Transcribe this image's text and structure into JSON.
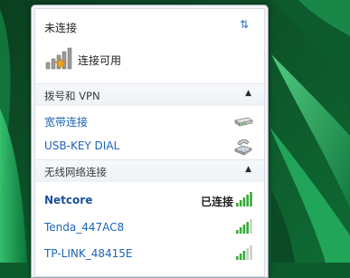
{
  "header": {
    "status_text": "未连接",
    "refresh_glyph": "⇅",
    "connection_label": "连接可用"
  },
  "sections": {
    "dialup": {
      "title": "拨号和 VPN",
      "items": [
        {
          "label": "宽带连接",
          "icon": "modem-icon"
        },
        {
          "label": "USB-KEY DIAL",
          "icon": "phone-icon"
        }
      ]
    },
    "wireless": {
      "title": "无线网络连接",
      "items": [
        {
          "label": "Netcore",
          "status": "已连接",
          "signal": 5
        },
        {
          "label": "Tenda_447AC8",
          "signal": 4
        },
        {
          "label": "TP-LINK_48415E",
          "signal": 3
        }
      ]
    }
  },
  "colors": {
    "link": "#1c63b7",
    "signal": "#3aa83a",
    "accent_star": "#f0a81c"
  }
}
